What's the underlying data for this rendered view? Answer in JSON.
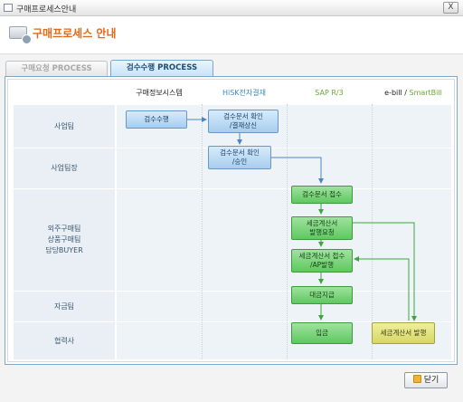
{
  "window": {
    "title": "구매프로세스안내",
    "close_label": "X"
  },
  "header": {
    "title": "구매프로세스 안내"
  },
  "tabs": [
    {
      "label": "구매요청 PROCESS",
      "active": false
    },
    {
      "label": "검수수행 PROCESS",
      "active": true
    }
  ],
  "columns": {
    "c1": "구매정보시스템",
    "c2": "HiSK전자결재",
    "c3": "SAP R/3",
    "c4_prefix": "e-bill /",
    "c4_suffix": "SmartBill"
  },
  "lanes": [
    {
      "label": "사업팀"
    },
    {
      "label": "사업팀장"
    },
    {
      "label": "외주구매팀\n상품구매팀\n담당BUYER"
    },
    {
      "label": "자금팀"
    },
    {
      "label": "협력사"
    }
  ],
  "boxes": {
    "b1": "검수수행",
    "b2": "검수문서 확인\n/결재상신",
    "b3": "검수문서 확인\n/승인",
    "b4": "검수문서 접수",
    "b5": "세금계산서\n발행요청",
    "b6": "세금계산서 접수\n/AP발행",
    "b7": "대금지급",
    "b8": "입금",
    "b9": "세금계산서 발행"
  },
  "colors": {
    "accent": "#e06a1a",
    "blue_box": "#a8cdee",
    "green_box": "#5fc85f",
    "olive_box": "#d7d766"
  },
  "footer": {
    "close_button": "닫기"
  }
}
